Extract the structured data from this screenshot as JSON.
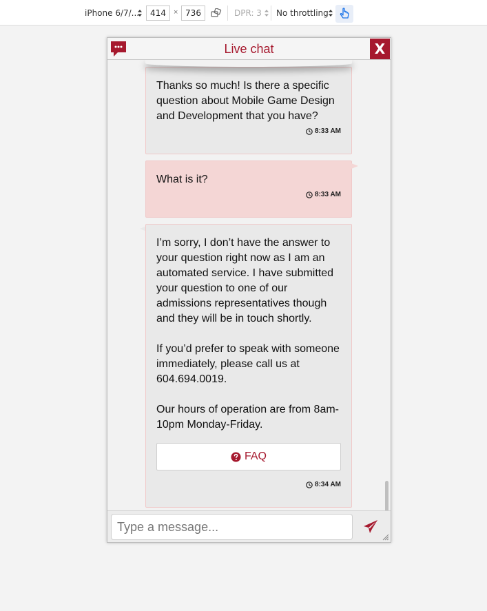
{
  "devtools": {
    "device": "iPhone 6/7/...",
    "width": "414",
    "height": "736",
    "times": "×",
    "dpr": "DPR: 3",
    "throttling": "No throttling"
  },
  "chat": {
    "title": "Live chat",
    "close_label": "X",
    "accent": "#a6192e",
    "messages": [
      {
        "from": "bot",
        "text": "Thanks so much! Is there a specific question about Mobile Game Design and Development that you have?",
        "time": "8:33 AM"
      },
      {
        "from": "user",
        "text": "What is it?",
        "time": "8:33 AM"
      },
      {
        "from": "bot",
        "text": "I’m sorry, I don’t have the answer to your question right now as I am an automated service. I have submitted your question to one of our admissions representatives though and they will be in touch shortly.\n\nIf you’d prefer to speak with someone immediately, please call us at 604.694.0019.\n\nOur hours of operation are from 8am-10pm Monday-Friday.",
        "faq_label": "FAQ",
        "time": "8:34 AM"
      }
    ],
    "input_placeholder": "Type a message..."
  }
}
